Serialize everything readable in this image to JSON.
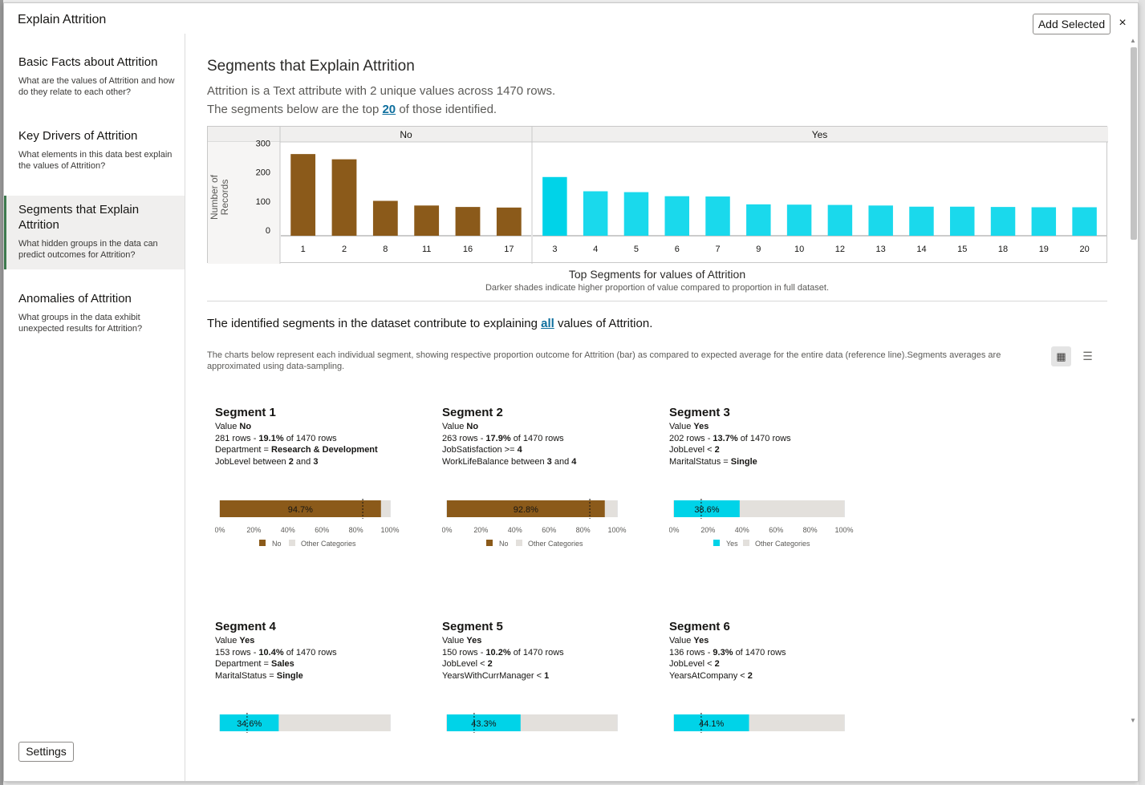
{
  "dialog": {
    "title": "Explain Attrition",
    "add_selected": "Add Selected",
    "close_glyph": "×"
  },
  "sidebar": {
    "items": [
      {
        "title": "Basic Facts about Attrition",
        "desc": "What are the values of Attrition and how do they relate to each other?"
      },
      {
        "title": "Key Drivers of Attrition",
        "desc": "What elements in this data best explain the values of Attrition?"
      },
      {
        "title": "Segments that Explain Attrition",
        "desc": "What hidden groups in the data can predict outcomes for Attrition?",
        "active": true
      },
      {
        "title": "Anomalies of Attrition",
        "desc": "What groups in the data exhibit unexpected results for Attrition?"
      }
    ],
    "settings": "Settings"
  },
  "main": {
    "heading": "Segments that Explain Attrition",
    "intro1": "Attrition is a Text attribute with 2 unique values across 1470 rows.",
    "intro2_before": "The segments below are the top ",
    "intro2_link": "20",
    "intro2_after": " of those identified.",
    "caption": "Top Segments for values of Attrition",
    "caption_sub": "Darker shades indicate higher proportion of value compared to proportion in full dataset.",
    "explain_before": "The identified segments in the dataset contribute to explaining ",
    "explain_link": "all",
    "explain_after": " values of Attrition.",
    "desc": "The charts below represent each individual segment, showing respective proportion outcome for Attrition (bar) as compared to expected average for the entire data (reference line).Segments averages are approximated using data-sampling.",
    "grid_view_icon": "grid-icon",
    "list_view_icon": "list-icon"
  },
  "colors": {
    "no": "#8b5a1a",
    "yes": "#00d3e8",
    "yes_light": "#1ad9ec",
    "other": "#e3e0dc"
  },
  "chart_data": {
    "type": "bar",
    "ylabel": "Number of Records",
    "yticks": [
      0,
      100,
      200,
      300
    ],
    "ylim": [
      0,
      320
    ],
    "groups": [
      {
        "name": "No",
        "categories": [
          "1",
          "2",
          "8",
          "11",
          "16",
          "17"
        ],
        "values": [
          281,
          263,
          120,
          104,
          99,
          97
        ]
      },
      {
        "name": "Yes",
        "categories": [
          "3",
          "4",
          "5",
          "6",
          "7",
          "9",
          "10",
          "12",
          "13",
          "14",
          "15",
          "18",
          "19",
          "20"
        ],
        "values": [
          202,
          153,
          150,
          136,
          135,
          108,
          107,
          106,
          104,
          100,
          100,
          99,
          98,
          98
        ]
      }
    ]
  },
  "segments": [
    {
      "title": "Segment 1",
      "value_label": "Value",
      "value": "No",
      "rows": "281 rows",
      "pct": "19.1%",
      "of": "of 1470 rows",
      "c1_key": "Department",
      "c1_op": " = ",
      "c1_val": "Research & Development",
      "c2_key": "JobLevel between ",
      "c2_a": "2",
      "c2_and": " and ",
      "c2_b": "3",
      "bar_pct": 94.7,
      "ref_pct": 84,
      "bar_label": "94.7%",
      "legend_value": "No",
      "legend_other": "Other Categories",
      "color": "#8b5a1a"
    },
    {
      "title": "Segment 2",
      "value_label": "Value",
      "value": "No",
      "rows": "263 rows",
      "pct": "17.9%",
      "of": "of 1470 rows",
      "c1_key": "JobSatisfaction",
      "c1_op": " >= ",
      "c1_val": "4",
      "c2_key": "WorkLifeBalance between ",
      "c2_a": "3",
      "c2_and": " and ",
      "c2_b": "4",
      "bar_pct": 92.8,
      "ref_pct": 84,
      "bar_label": "92.8%",
      "legend_value": "No",
      "legend_other": "Other Categories",
      "color": "#8b5a1a"
    },
    {
      "title": "Segment 3",
      "value_label": "Value",
      "value": "Yes",
      "rows": "202 rows",
      "pct": "13.7%",
      "of": "of 1470 rows",
      "c1_key": "JobLevel",
      "c1_op": " < ",
      "c1_val": "2",
      "c2_key": "MaritalStatus",
      "c2_a": " = ",
      "c2_and": "",
      "c2_b": "Single",
      "bar_pct": 38.6,
      "ref_pct": 16,
      "bar_label": "38.6%",
      "legend_value": "Yes",
      "legend_other": "Other Categories",
      "color": "#00d3e8"
    },
    {
      "title": "Segment 4",
      "value_label": "Value",
      "value": "Yes",
      "rows": "153 rows",
      "pct": "10.4%",
      "of": "of 1470 rows",
      "c1_key": "Department",
      "c1_op": " = ",
      "c1_val": "Sales",
      "c2_key": "MaritalStatus",
      "c2_a": " = ",
      "c2_and": "",
      "c2_b": "Single",
      "bar_pct": 34.6,
      "ref_pct": 16,
      "bar_label": "34.6%",
      "color": "#00d3e8"
    },
    {
      "title": "Segment 5",
      "value_label": "Value",
      "value": "Yes",
      "rows": "150 rows",
      "pct": "10.2%",
      "of": "of 1470 rows",
      "c1_key": "JobLevel",
      "c1_op": " < ",
      "c1_val": "2",
      "c2_key": "YearsWithCurrManager",
      "c2_a": " < ",
      "c2_and": "",
      "c2_b": "1",
      "bar_pct": 43.3,
      "ref_pct": 16,
      "bar_label": "43.3%",
      "color": "#00d3e8"
    },
    {
      "title": "Segment 6",
      "value_label": "Value",
      "value": "Yes",
      "rows": "136 rows",
      "pct": "9.3%",
      "of": "of 1470 rows",
      "c1_key": "JobLevel",
      "c1_op": " < ",
      "c1_val": "2",
      "c2_key": "YearsAtCompany",
      "c2_a": " < ",
      "c2_and": "",
      "c2_b": "2",
      "bar_pct": 44.1,
      "ref_pct": 16,
      "bar_label": "44.1%",
      "color": "#00d3e8"
    }
  ],
  "axis_ticks": [
    "0%",
    "20%",
    "40%",
    "60%",
    "80%",
    "100%"
  ]
}
